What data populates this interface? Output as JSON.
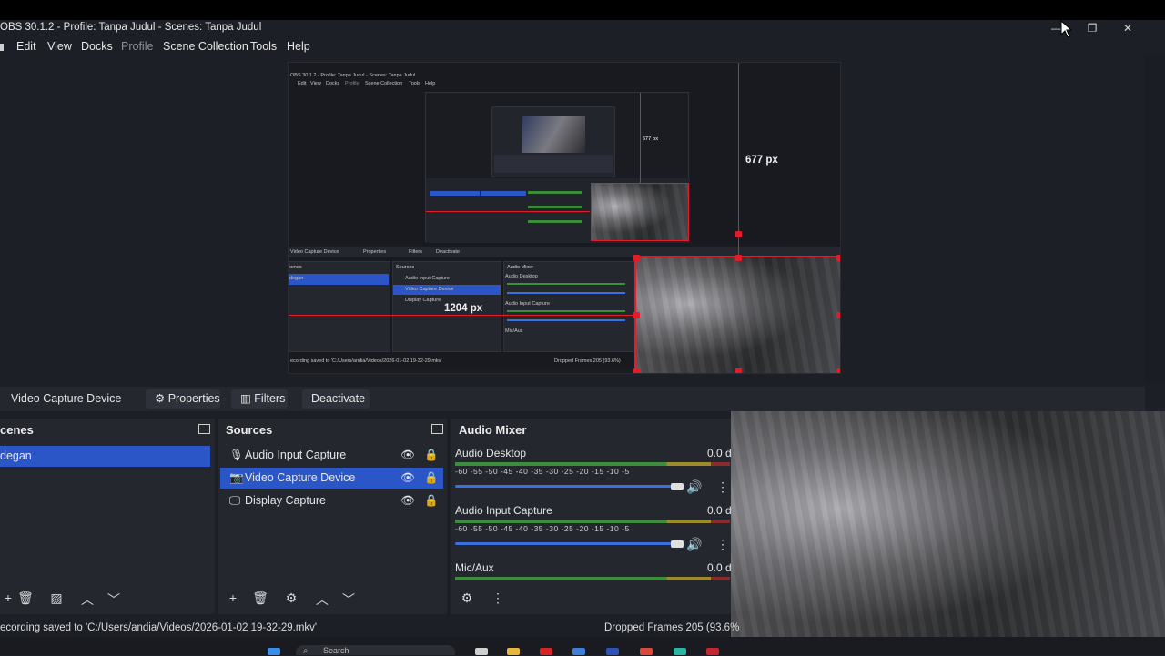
{
  "window": {
    "title": "OBS 30.1.2 - Profile: Tanpa Judul - Scenes: Tanpa Judul"
  },
  "menu": [
    "Edit",
    "View",
    "Docks",
    "Profile",
    "Scene Collection",
    "Tools",
    "Help"
  ],
  "preview": {
    "height_label": "677 px",
    "width_label": "1204 px",
    "nested": {
      "title": "OBS 30.1.2 - Profile: Tanpa Judul - Scenes: Tanpa Judul",
      "menu": [
        "Edit",
        "View",
        "Docks",
        "Profile",
        "Scene Collection",
        "Tools",
        "Help"
      ],
      "inner_height_label": "677 px",
      "source_label": "Video Capture Device",
      "properties": "Properties",
      "filters": "Filters",
      "deactivate": "Deactivate",
      "scenes_header": "cenes",
      "scene_item": "degan",
      "sources_header": "Sources",
      "sources": [
        "Audio Input Capture",
        "Video Capture Device",
        "Display Capture"
      ],
      "mixer_header": "Audio Mixer",
      "mixer": [
        "Audio Desktop",
        "Audio Input Capture",
        "Mic/Aux"
      ],
      "status_left": "ecording saved to 'C:/Users/andia/Videos/2026-01-02 19-32-29.mkv'",
      "status_right": "Dropped Frames 205 (93.6%)"
    }
  },
  "source_toolbar": {
    "label": "Video Capture Device",
    "properties": "Properties",
    "filters": "Filters",
    "deactivate": "Deactivate"
  },
  "scenes": {
    "header": "cenes",
    "items": [
      "degan"
    ]
  },
  "sources": {
    "header": "Sources",
    "items": [
      "Audio Input Capture",
      "Video Capture Device",
      "Display Capture"
    ]
  },
  "mixer": {
    "header": "Audio Mixer",
    "scale": "-60  -55  -50  -45  -40  -35  -30  -25  -20  -15  -10  -5",
    "channels": [
      {
        "name": "Audio Desktop",
        "db": "0.0 d"
      },
      {
        "name": "Audio Input Capture",
        "db": "0.0 d"
      },
      {
        "name": "Mic/Aux",
        "db": "0.0 d"
      }
    ]
  },
  "status": {
    "left": "ecording saved to 'C:/Users/andia/Videos/2026-01-02 19-32-29.mkv'",
    "right": "Dropped Frames 205 (93.6%"
  },
  "taskbar": {
    "search": "Search"
  }
}
